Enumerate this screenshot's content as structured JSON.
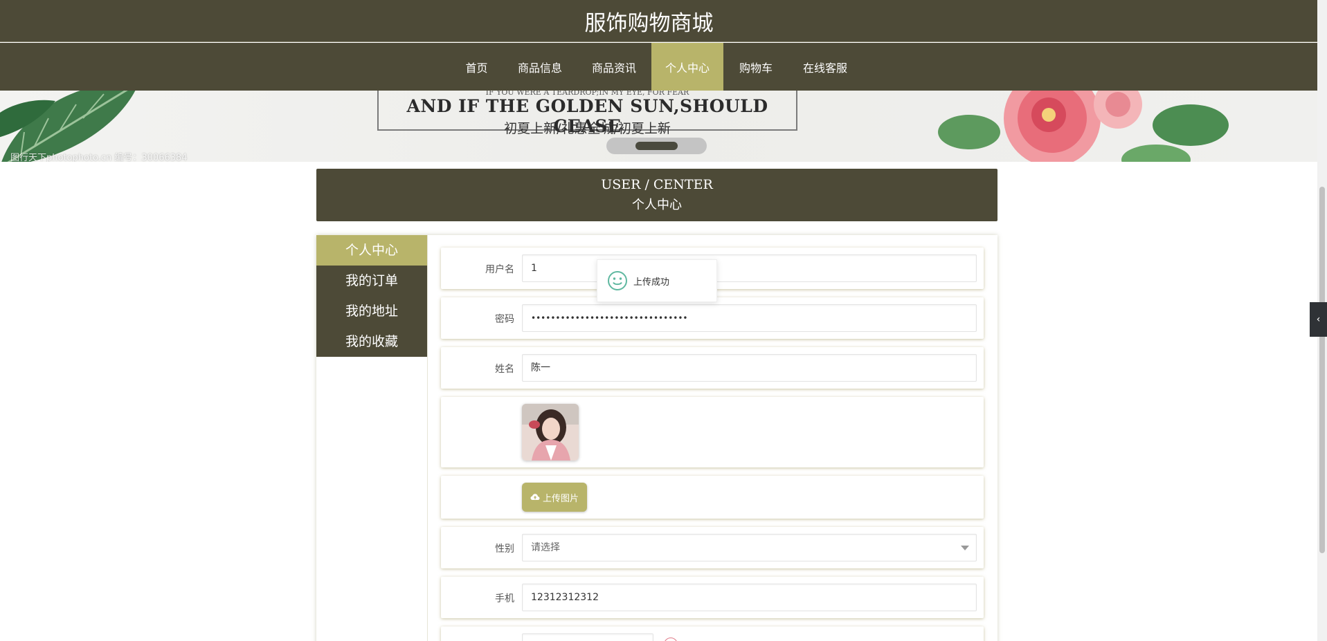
{
  "site": {
    "title": "服饰购物商城"
  },
  "nav": [
    {
      "label": "首页"
    },
    {
      "label": "商品信息"
    },
    {
      "label": "商品资讯"
    },
    {
      "label": "个人中心",
      "active": true
    },
    {
      "label": "购物车"
    },
    {
      "label": "在线客服"
    }
  ],
  "banner": {
    "small_text": "IF YOU WERE A TEARDROP;IN MY EYE, FOR FEAR",
    "big_text": "AND IF THE GOLDEN SUN,SHOULD CEASE",
    "sub_text": "初夏上新/礼惠全城/初夏上新",
    "watermark": "图行天下photophoto.cn 编号：30066384"
  },
  "section": {
    "title_en": "USER / CENTER",
    "title_cn": "个人中心"
  },
  "sidebar": [
    {
      "label": "个人中心",
      "active": true
    },
    {
      "label": "我的订单"
    },
    {
      "label": "我的地址"
    },
    {
      "label": "我的收藏"
    }
  ],
  "form": {
    "username": {
      "label": "用户名",
      "value": "1"
    },
    "password": {
      "label": "密码",
      "value": "••••••••••••••••••••••••••••••••"
    },
    "name": {
      "label": "姓名",
      "value": "陈一"
    },
    "upload": {
      "label": "上传图片"
    },
    "gender": {
      "label": "性别",
      "value": "请选择"
    },
    "phone": {
      "label": "手机",
      "value": "12312312312"
    }
  },
  "toast": {
    "message": "上传成功"
  },
  "colors": {
    "header": "#4d4a37",
    "accent": "#b8b46a"
  },
  "side_tab": {
    "icon": "chevron-left-icon"
  }
}
